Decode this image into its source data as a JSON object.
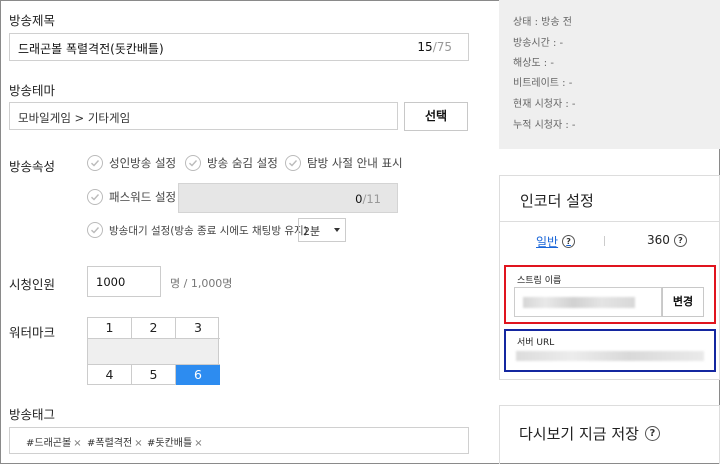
{
  "form": {
    "title_label": "방송제목",
    "title_value": "드래곤볼 폭렬격전(돗칸배틀)",
    "title_count": "15",
    "title_max": "/75",
    "theme_label": "방송테마",
    "theme_value": "모바일게임 > 기타게임",
    "theme_button": "선택",
    "attr_label": "방송속성",
    "checkboxes": {
      "adult": "성인방송 설정",
      "hidden": "방송 숨김 설정",
      "notice": "탐방 사절 안내 표시",
      "password": "패스워드 설정",
      "waiting": "방송대기 설정(방송 종료 시에도 채팅방 유지)"
    },
    "password_count": "0",
    "password_max": "/11",
    "waiting_select": "2분",
    "viewers_label": "시청인원",
    "viewers_value": "1000",
    "viewers_max": "명 / 1,000명",
    "watermark_label": "워터마크",
    "watermark_cells": [
      "1",
      "2",
      "3",
      "4",
      "5",
      "6"
    ],
    "watermark_selected": "6",
    "tags_label": "방송태그",
    "tags": [
      "#드래곤볼",
      "#폭렬격전",
      "#돗칸배틀"
    ],
    "tag_remove": "×"
  },
  "status": {
    "state": "상태 : 방송 전",
    "time": "방송시간 : -",
    "resolution": "해상도 : -",
    "bitrate": "비트레이트 : -",
    "current_viewers": "현재 시청자 : -",
    "total_viewers": "누적 시청자 : -"
  },
  "encoder": {
    "title": "인코더 설정",
    "tab_normal": "일반",
    "tab_360": "360",
    "help": "?",
    "stream_label": "스트림 이름",
    "change_button": "변경",
    "server_label": "서버 URL"
  },
  "replay": {
    "title": "다시보기 지금 저장",
    "help": "?"
  },
  "colors": {
    "accent": "#2d8cf0",
    "link": "#1a66d8",
    "highlight_red": "#e0141e",
    "highlight_blue": "#1427a0"
  }
}
